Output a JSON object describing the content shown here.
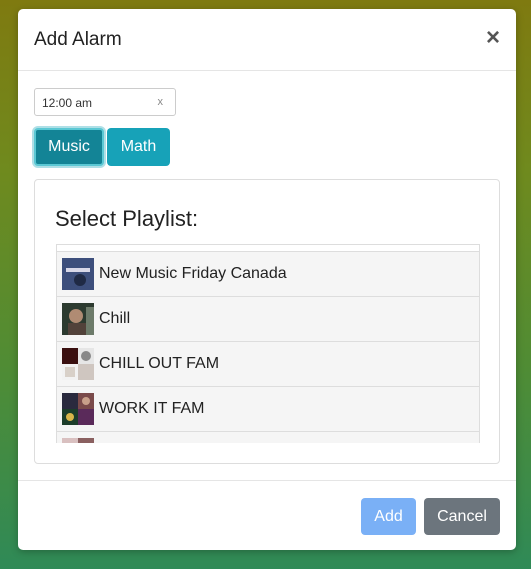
{
  "modal": {
    "title": "Add Alarm",
    "close": "×"
  },
  "time": {
    "value": "12:00 am",
    "clear": "x"
  },
  "tabs": [
    {
      "label": "Music",
      "active": true
    },
    {
      "label": "Math",
      "active": false
    }
  ],
  "playlist": {
    "heading": "Select Playlist:",
    "items": [
      {
        "label": "New Music Friday Canada"
      },
      {
        "label": "Chill"
      },
      {
        "label": "CHILL OUT FAM"
      },
      {
        "label": "WORK IT FAM"
      },
      {
        "label": ""
      }
    ]
  },
  "footer": {
    "add": "Add",
    "cancel": "Cancel"
  },
  "colors": {
    "info": "#17a2b8",
    "info_active": "#138496",
    "primary_disabled": "#7ab0f6",
    "secondary": "#6c757d"
  }
}
